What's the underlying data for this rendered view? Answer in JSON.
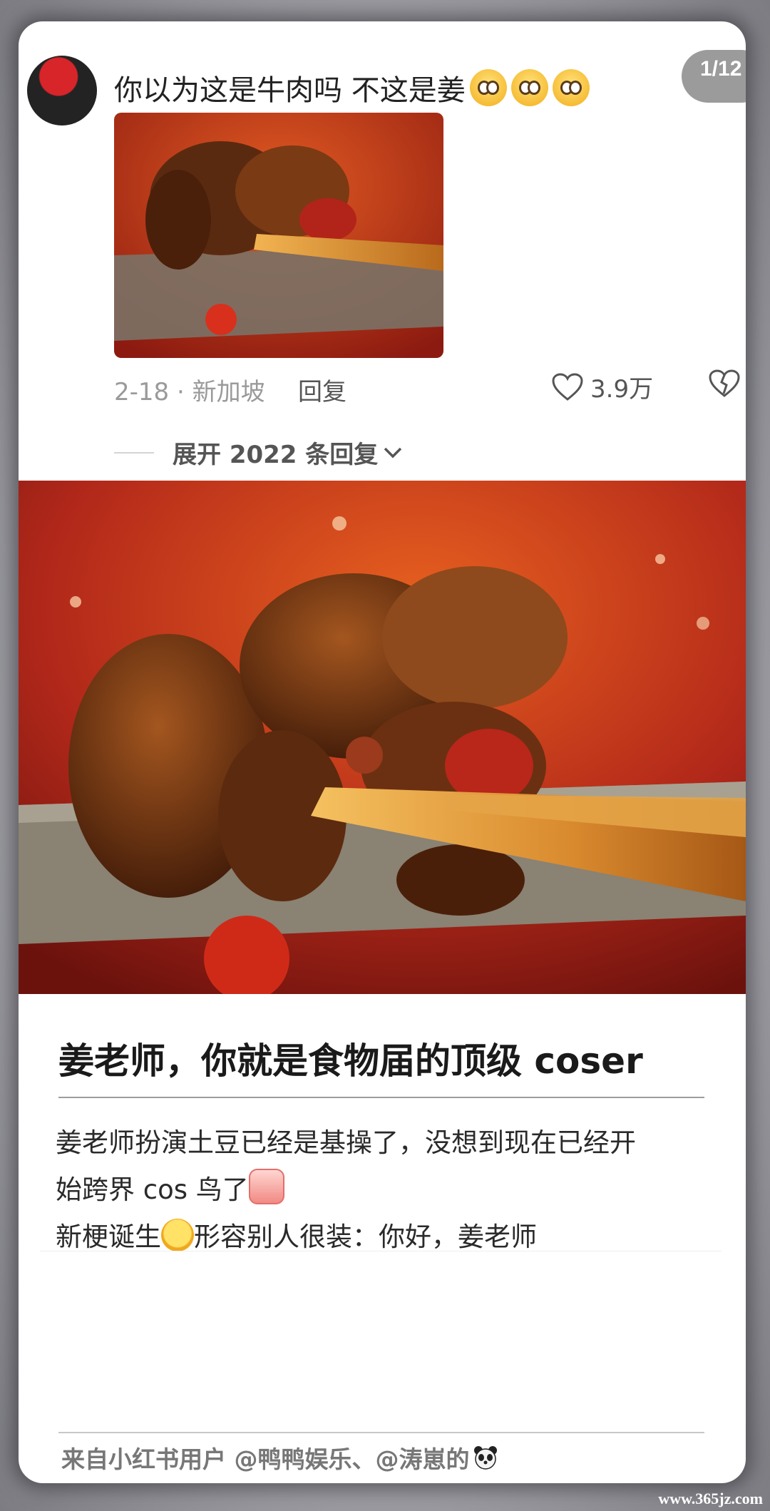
{
  "comment": {
    "page_indicator": "1/12",
    "text": "你以为这是牛肉吗 不这是姜",
    "emoji_icons": [
      "pleading-face-icon",
      "pleading-face-icon",
      "pleading-face-icon"
    ],
    "date_location": "2-18 · 新加坡",
    "reply_label": "回复",
    "like_count": "3.9万",
    "expand_label": "展开 2022 条回复"
  },
  "article": {
    "title": "姜老师，你就是食物届的顶级 coser",
    "body_line1": "姜老师扮演土豆已经是基操了，没想到现在已经开",
    "body_line2": "始跨界 cos 鸟了",
    "body_line3_a": "新梗诞生",
    "body_line3_b": "形容别人很装：你好，姜老师"
  },
  "footer": {
    "credit": "来自小红书用户 @鸭鸭娱乐、@涛崽的"
  },
  "watermark": "www.365jz.com",
  "colors": {
    "accent_red": "#c8261b",
    "text_dark": "#222222",
    "text_muted": "#9a9a9a"
  }
}
